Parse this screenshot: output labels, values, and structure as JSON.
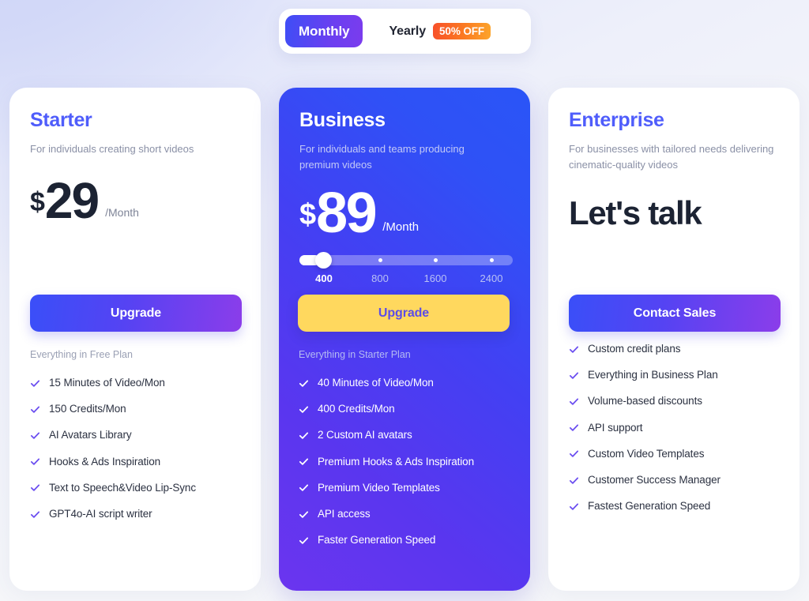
{
  "billing_toggle": {
    "monthly_label": "Monthly",
    "yearly_label": "Yearly",
    "discount_badge": "50% OFF",
    "selected": "Monthly",
    "monthly_gradient_from": "#3e4ef6",
    "monthly_gradient_to": "#7b3cee",
    "badge_gradient_from": "#f8502a",
    "badge_gradient_to": "#fca52b"
  },
  "plans": [
    {
      "name": "Starter",
      "description": "For individuals creating short videos",
      "currency": "$",
      "amount": "29",
      "period": "/Month",
      "cta_label": "Upgrade",
      "features_head": "Everything in Free Plan",
      "features": [
        "15 Minutes of Video/Mon",
        "150 Credits/Mon",
        "AI Avatars Library",
        "Hooks & Ads Inspiration",
        "Text to Speech&Video Lip-Sync",
        "GPT4o-AI script writer"
      ],
      "accent_color": "#4f5dfb",
      "check_color": "#6b4ef0"
    },
    {
      "name": "Business",
      "description": "For individuals and teams producing premium videos",
      "currency": "$",
      "amount": "89",
      "period": "/Month",
      "cta_label": "Upgrade",
      "features_head": "Everything in Starter Plan",
      "features": [
        "40 Minutes of Video/Mon",
        "400 Credits/Mon",
        "2 Custom AI avatars",
        "Premium Hooks & Ads Inspiration",
        "Premium Video Templates",
        "API access",
        "Faster Generation Speed"
      ],
      "credits_slider": {
        "options": [
          "400",
          "800",
          "1600",
          "2400"
        ],
        "selected": "400",
        "selected_index": 0
      },
      "card_gradient_from": "#6b35ef",
      "card_gradient_to": "#2a55f7",
      "cta_color": "#ffd85e",
      "cta_text_color": "#5b4ce8"
    },
    {
      "name": "Enterprise",
      "description": "For businesses with tailored needs delivering cinematic-quality videos",
      "price_text": "Let's talk",
      "cta_label": "Contact Sales",
      "features": [
        "Custom credit plans",
        "Everything in Business Plan",
        "Volume-based discounts",
        "API support",
        "Custom Video Templates",
        "Customer Success Manager",
        "Fastest Generation Speed"
      ],
      "accent_color": "#4f5dfb",
      "check_color": "#6b4ef0"
    }
  ]
}
